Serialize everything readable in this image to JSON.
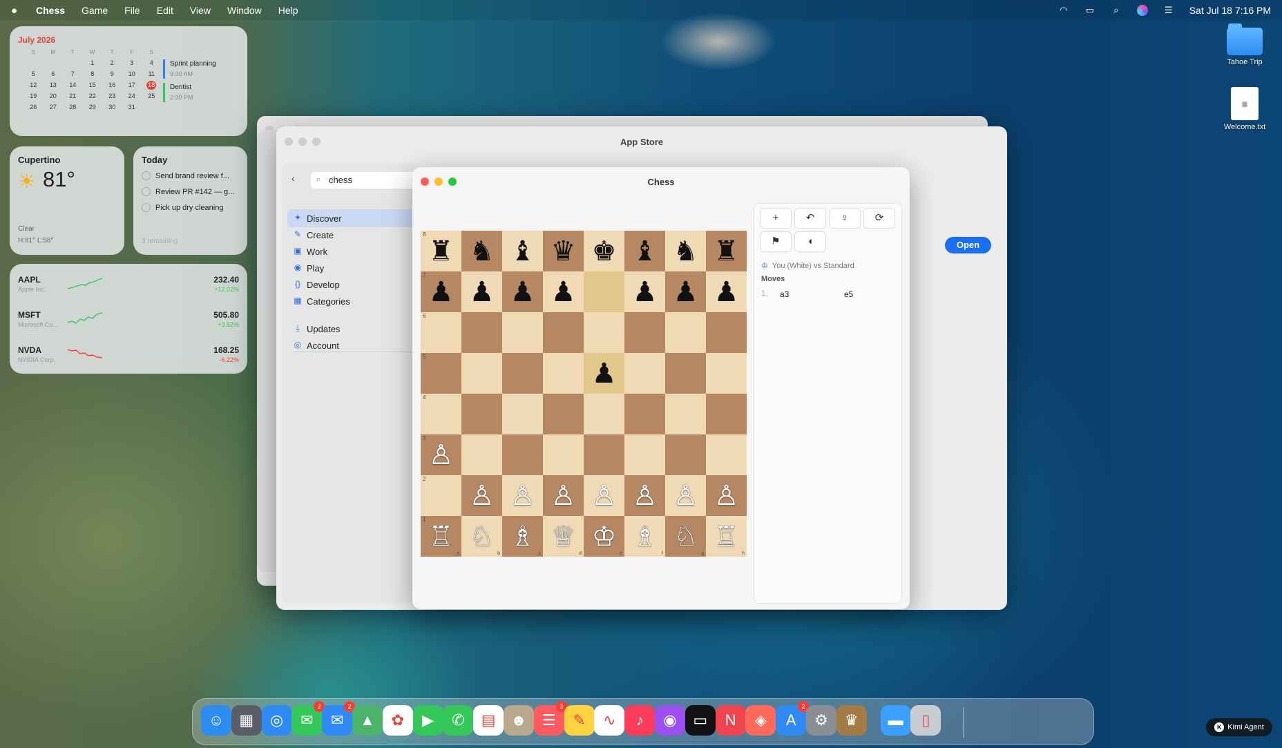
{
  "menubar": {
    "app_name": "Chess",
    "menus": [
      "Game",
      "File",
      "Edit",
      "View",
      "Window",
      "Help"
    ],
    "datetime": "Sat Jul 18  7:16 PM"
  },
  "calendar": {
    "month": "July 2026",
    "weekdays": [
      "S",
      "M",
      "T",
      "W",
      "T",
      "F",
      "S"
    ],
    "days": [
      "",
      "",
      "",
      "1",
      "2",
      "3",
      "4",
      "5",
      "6",
      "7",
      "8",
      "9",
      "10",
      "11",
      "12",
      "13",
      "14",
      "15",
      "16",
      "17",
      "18",
      "19",
      "20",
      "21",
      "22",
      "23",
      "24",
      "25",
      "26",
      "27",
      "28",
      "29",
      "30",
      "31",
      "",
      ""
    ],
    "today": "18",
    "events": [
      {
        "title": "Sprint planning",
        "time": "9:30 AM"
      },
      {
        "title": "Dentist",
        "time": "2:30 PM"
      }
    ]
  },
  "weather": {
    "city": "Cupertino",
    "temp": "81°",
    "condition": "Clear",
    "hilo": "H:81° L:58°"
  },
  "reminders": {
    "title": "Today",
    "items": [
      "Send brand review f...",
      "Review PR #142 — g...",
      "Pick up dry cleaning"
    ],
    "remaining": "3 remaining"
  },
  "stocks": [
    {
      "symbol": "AAPL",
      "name": "Apple Inc.",
      "price": "232.40",
      "change": "+12.02%",
      "color": "#34c759"
    },
    {
      "symbol": "MSFT",
      "name": "Microsoft Co...",
      "price": "505.80",
      "change": "+3.52%",
      "color": "#34c759"
    },
    {
      "symbol": "NVDA",
      "name": "NVIDIA Corp.",
      "price": "168.25",
      "change": "-6.22%",
      "color": "#ff3b30"
    }
  ],
  "appstore": {
    "title": "App Store",
    "search_value": "chess",
    "nav": [
      {
        "label": "Discover",
        "icon": "sparkles-icon"
      },
      {
        "label": "Create",
        "icon": "brush-icon"
      },
      {
        "label": "Work",
        "icon": "briefcase-icon"
      },
      {
        "label": "Play",
        "icon": "gamecontroller-icon"
      },
      {
        "label": "Develop",
        "icon": "braces-icon"
      },
      {
        "label": "Categories",
        "icon": "grid-icon"
      },
      {
        "label": "Updates",
        "icon": "download-icon"
      },
      {
        "label": "Account",
        "icon": "person-icon"
      }
    ],
    "open_button": "Open"
  },
  "chess": {
    "title": "Chess",
    "board": [
      [
        "♜",
        "♞",
        "♝",
        "♛",
        "♚",
        "♝",
        "♞",
        "♜"
      ],
      [
        "♟",
        "♟",
        "♟",
        "♟",
        "",
        "♟",
        "♟",
        "♟"
      ],
      [
        "",
        "",
        "",
        "",
        "",
        "",
        "",
        ""
      ],
      [
        "",
        "",
        "",
        "",
        "♟",
        "",
        "",
        ""
      ],
      [
        "",
        "",
        "",
        "",
        "",
        "",
        "",
        ""
      ],
      [
        "♙",
        "",
        "",
        "",
        "",
        "",
        "",
        ""
      ],
      [
        "",
        "♙",
        "♙",
        "♙",
        "♙",
        "♙",
        "♙",
        "♙"
      ],
      [
        "♖",
        "♘",
        "♗",
        "♕",
        "♔",
        "♗",
        "♘",
        "♖"
      ]
    ],
    "highlight": [
      [
        1,
        4
      ],
      [
        3,
        4
      ]
    ],
    "ranks": [
      "8",
      "7",
      "6",
      "5",
      "4",
      "3",
      "2",
      "1"
    ],
    "files": [
      "a",
      "b",
      "c",
      "d",
      "e",
      "f",
      "g",
      "h"
    ],
    "matchup": "You (White) vs Standard",
    "moves_label": "Moves",
    "moves": [
      {
        "n": "1.",
        "white": "a3",
        "black": "e5"
      }
    ]
  },
  "desktop_items": [
    {
      "label": "Tahoe Trip"
    },
    {
      "label": "Welcome.txt"
    }
  ],
  "dock": [
    {
      "name": "finder-icon",
      "color": "#2d8cf0"
    },
    {
      "name": "launchpad-icon",
      "color": "#5b5e66"
    },
    {
      "name": "safari-icon",
      "color": "#2f8af5"
    },
    {
      "name": "messages-icon",
      "color": "#34c759",
      "badge": "2"
    },
    {
      "name": "mail-icon",
      "color": "#2f8af5",
      "badge": "2"
    },
    {
      "name": "maps-icon",
      "color": "#4cb36a"
    },
    {
      "name": "photos-icon",
      "color": "#ffffff"
    },
    {
      "name": "facetime-icon",
      "color": "#34c759"
    },
    {
      "name": "phone-icon",
      "color": "#34c759"
    },
    {
      "name": "calendar-icon",
      "color": "#ffffff"
    },
    {
      "name": "contacts-icon",
      "color": "#b9a98c"
    },
    {
      "name": "reminders-icon",
      "color": "#ff5a5f",
      "badge": "3"
    },
    {
      "name": "notes-icon",
      "color": "#ffd23f"
    },
    {
      "name": "freeform-icon",
      "color": "#ffffff"
    },
    {
      "name": "music-icon",
      "color": "#fa3b5a"
    },
    {
      "name": "podcasts-icon",
      "color": "#9b4ff0"
    },
    {
      "name": "tv-icon",
      "color": "#111111"
    },
    {
      "name": "news-icon",
      "color": "#f0444f"
    },
    {
      "name": "games-icon",
      "color": "#ff6a5a"
    },
    {
      "name": "appstore-icon",
      "color": "#2f8af5",
      "badge": "2"
    },
    {
      "name": "settings-icon",
      "color": "#8a8d93"
    },
    {
      "name": "chess-icon",
      "color": "#a57b45"
    },
    {
      "name": "downloads-folder-icon",
      "color": "#3aa0ff"
    },
    {
      "name": "trash-icon",
      "color": "#c9ccd1"
    }
  ],
  "agent": {
    "label": "Kimi Agent",
    "initial": "K"
  }
}
